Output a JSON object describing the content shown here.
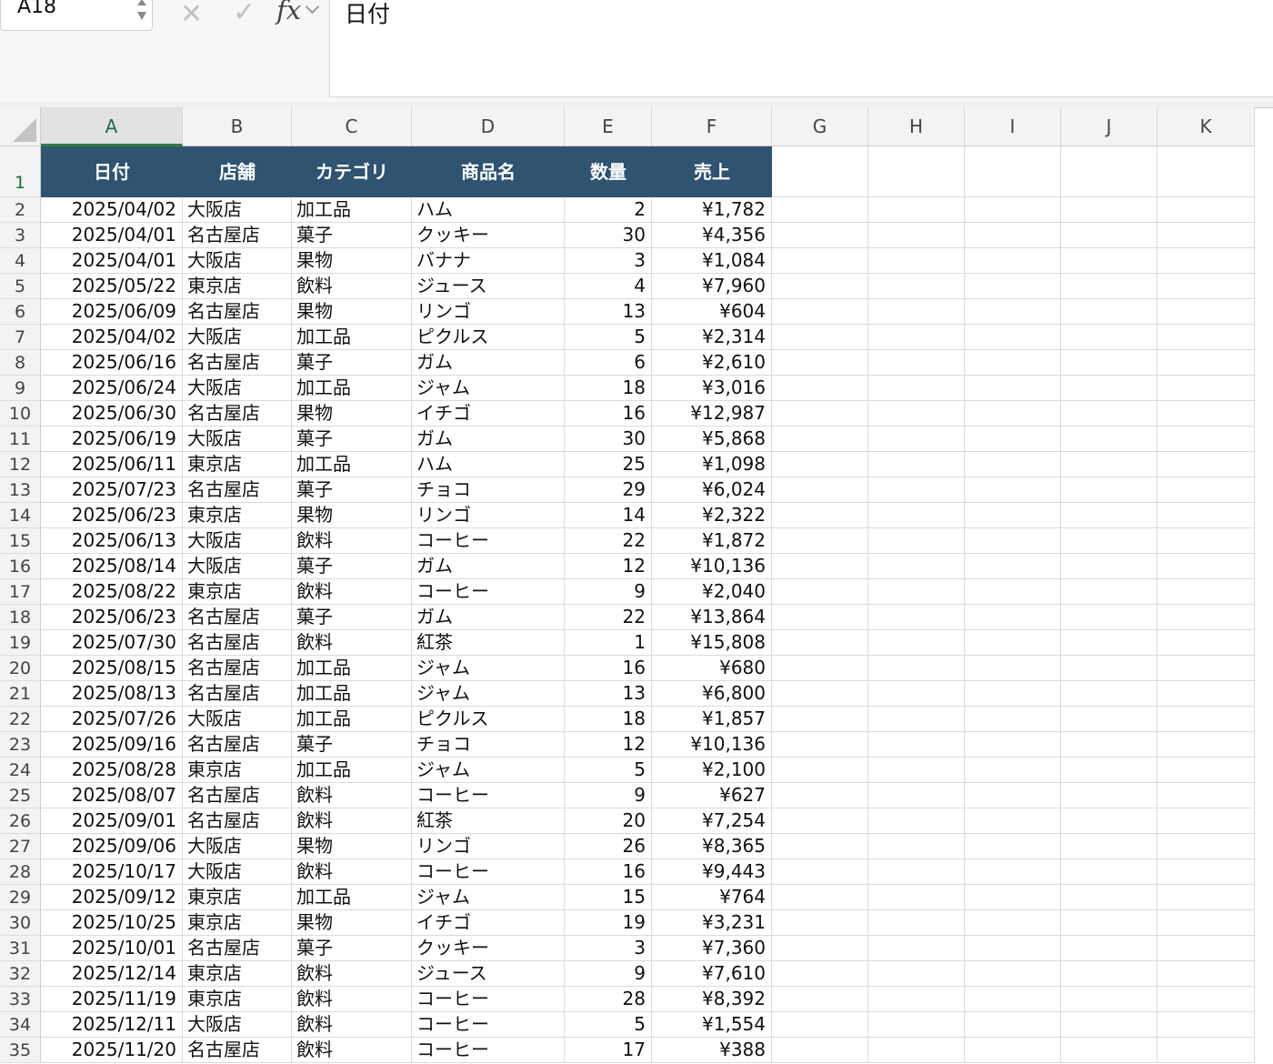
{
  "formula_bar": {
    "name_box": "A18",
    "formula_value": "日付"
  },
  "columns": [
    "A",
    "B",
    "C",
    "D",
    "E",
    "F",
    "G",
    "H",
    "I",
    "J",
    "K"
  ],
  "selected_column": "A",
  "header_row": {
    "row_number": "1",
    "labels": [
      "日付",
      "店舗",
      "カテゴリ",
      "商品名",
      "数量",
      "売上"
    ],
    "fill_color": "#2f5370"
  },
  "rows": [
    {
      "n": "2",
      "date": "2025/04/02",
      "store": "大阪店",
      "category": "加工品",
      "product": "ハム",
      "qty": "2",
      "sales": "¥1,782"
    },
    {
      "n": "3",
      "date": "2025/04/01",
      "store": "名古屋店",
      "category": "菓子",
      "product": "クッキー",
      "qty": "30",
      "sales": "¥4,356"
    },
    {
      "n": "4",
      "date": "2025/04/01",
      "store": "大阪店",
      "category": "果物",
      "product": "バナナ",
      "qty": "3",
      "sales": "¥1,084"
    },
    {
      "n": "5",
      "date": "2025/05/22",
      "store": "東京店",
      "category": "飲料",
      "product": "ジュース",
      "qty": "4",
      "sales": "¥7,960"
    },
    {
      "n": "6",
      "date": "2025/06/09",
      "store": "名古屋店",
      "category": "果物",
      "product": "リンゴ",
      "qty": "13",
      "sales": "¥604"
    },
    {
      "n": "7",
      "date": "2025/04/02",
      "store": "大阪店",
      "category": "加工品",
      "product": "ピクルス",
      "qty": "5",
      "sales": "¥2,314"
    },
    {
      "n": "8",
      "date": "2025/06/16",
      "store": "名古屋店",
      "category": "菓子",
      "product": "ガム",
      "qty": "6",
      "sales": "¥2,610"
    },
    {
      "n": "9",
      "date": "2025/06/24",
      "store": "大阪店",
      "category": "加工品",
      "product": "ジャム",
      "qty": "18",
      "sales": "¥3,016"
    },
    {
      "n": "10",
      "date": "2025/06/30",
      "store": "名古屋店",
      "category": "果物",
      "product": "イチゴ",
      "qty": "16",
      "sales": "¥12,987"
    },
    {
      "n": "11",
      "date": "2025/06/19",
      "store": "大阪店",
      "category": "菓子",
      "product": "ガム",
      "qty": "30",
      "sales": "¥5,868"
    },
    {
      "n": "12",
      "date": "2025/06/11",
      "store": "東京店",
      "category": "加工品",
      "product": "ハム",
      "qty": "25",
      "sales": "¥1,098"
    },
    {
      "n": "13",
      "date": "2025/07/23",
      "store": "名古屋店",
      "category": "菓子",
      "product": "チョコ",
      "qty": "29",
      "sales": "¥6,024"
    },
    {
      "n": "14",
      "date": "2025/06/23",
      "store": "東京店",
      "category": "果物",
      "product": "リンゴ",
      "qty": "14",
      "sales": "¥2,322"
    },
    {
      "n": "15",
      "date": "2025/06/13",
      "store": "大阪店",
      "category": "飲料",
      "product": "コーヒー",
      "qty": "22",
      "sales": "¥1,872"
    },
    {
      "n": "16",
      "date": "2025/08/14",
      "store": "大阪店",
      "category": "菓子",
      "product": "ガム",
      "qty": "12",
      "sales": "¥10,136"
    },
    {
      "n": "17",
      "date": "2025/08/22",
      "store": "東京店",
      "category": "飲料",
      "product": "コーヒー",
      "qty": "9",
      "sales": "¥2,040"
    },
    {
      "n": "18",
      "date": "2025/06/23",
      "store": "名古屋店",
      "category": "菓子",
      "product": "ガム",
      "qty": "22",
      "sales": "¥13,864"
    },
    {
      "n": "19",
      "date": "2025/07/30",
      "store": "名古屋店",
      "category": "飲料",
      "product": "紅茶",
      "qty": "1",
      "sales": "¥15,808"
    },
    {
      "n": "20",
      "date": "2025/08/15",
      "store": "名古屋店",
      "category": "加工品",
      "product": "ジャム",
      "qty": "16",
      "sales": "¥680"
    },
    {
      "n": "21",
      "date": "2025/08/13",
      "store": "名古屋店",
      "category": "加工品",
      "product": "ジャム",
      "qty": "13",
      "sales": "¥6,800"
    },
    {
      "n": "22",
      "date": "2025/07/26",
      "store": "大阪店",
      "category": "加工品",
      "product": "ピクルス",
      "qty": "18",
      "sales": "¥1,857"
    },
    {
      "n": "23",
      "date": "2025/09/16",
      "store": "名古屋店",
      "category": "菓子",
      "product": "チョコ",
      "qty": "12",
      "sales": "¥10,136"
    },
    {
      "n": "24",
      "date": "2025/08/28",
      "store": "東京店",
      "category": "加工品",
      "product": "ジャム",
      "qty": "5",
      "sales": "¥2,100"
    },
    {
      "n": "25",
      "date": "2025/08/07",
      "store": "名古屋店",
      "category": "飲料",
      "product": "コーヒー",
      "qty": "9",
      "sales": "¥627"
    },
    {
      "n": "26",
      "date": "2025/09/01",
      "store": "名古屋店",
      "category": "飲料",
      "product": "紅茶",
      "qty": "20",
      "sales": "¥7,254"
    },
    {
      "n": "27",
      "date": "2025/09/06",
      "store": "大阪店",
      "category": "果物",
      "product": "リンゴ",
      "qty": "26",
      "sales": "¥8,365"
    },
    {
      "n": "28",
      "date": "2025/10/17",
      "store": "大阪店",
      "category": "飲料",
      "product": "コーヒー",
      "qty": "16",
      "sales": "¥9,443"
    },
    {
      "n": "29",
      "date": "2025/09/12",
      "store": "東京店",
      "category": "加工品",
      "product": "ジャム",
      "qty": "15",
      "sales": "¥764"
    },
    {
      "n": "30",
      "date": "2025/10/25",
      "store": "東京店",
      "category": "果物",
      "product": "イチゴ",
      "qty": "19",
      "sales": "¥3,231"
    },
    {
      "n": "31",
      "date": "2025/10/01",
      "store": "名古屋店",
      "category": "菓子",
      "product": "クッキー",
      "qty": "3",
      "sales": "¥7,360"
    },
    {
      "n": "32",
      "date": "2025/12/14",
      "store": "東京店",
      "category": "飲料",
      "product": "ジュース",
      "qty": "9",
      "sales": "¥7,610"
    },
    {
      "n": "33",
      "date": "2025/11/19",
      "store": "東京店",
      "category": "飲料",
      "product": "コーヒー",
      "qty": "28",
      "sales": "¥8,392"
    },
    {
      "n": "34",
      "date": "2025/12/11",
      "store": "大阪店",
      "category": "飲料",
      "product": "コーヒー",
      "qty": "5",
      "sales": "¥1,554"
    },
    {
      "n": "35",
      "date": "2025/11/20",
      "store": "名古屋店",
      "category": "飲料",
      "product": "コーヒー",
      "qty": "17",
      "sales": "¥388"
    }
  ]
}
